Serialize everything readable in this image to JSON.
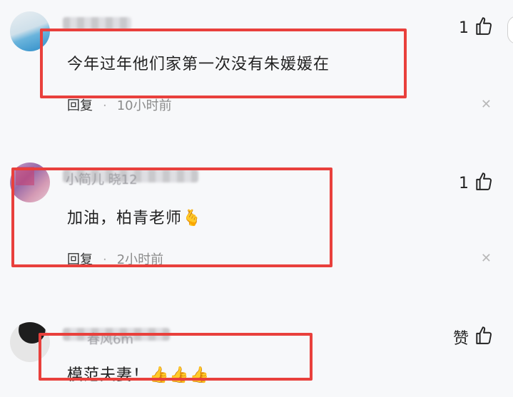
{
  "comments": [
    {
      "username": "",
      "text": "今年过年他们家第一次没有朱媛媛在",
      "emoji": "",
      "reply_label": "回复",
      "time": "10小时前",
      "likes": "1"
    },
    {
      "username": "小简儿 晓12",
      "text": "加油，柏青老师",
      "emoji": "🫰",
      "reply_label": "回复",
      "time": "2小时前",
      "likes": "1"
    },
    {
      "username": "春风6m",
      "text": "模范夫妻！",
      "emoji": "👍👍👍",
      "likes": "赞"
    }
  ],
  "icons": {
    "like": "thumbs-up-icon",
    "close": "close-icon"
  },
  "colors": {
    "highlight_box": "#e9403c",
    "meta_text": "#8b8b8b"
  }
}
